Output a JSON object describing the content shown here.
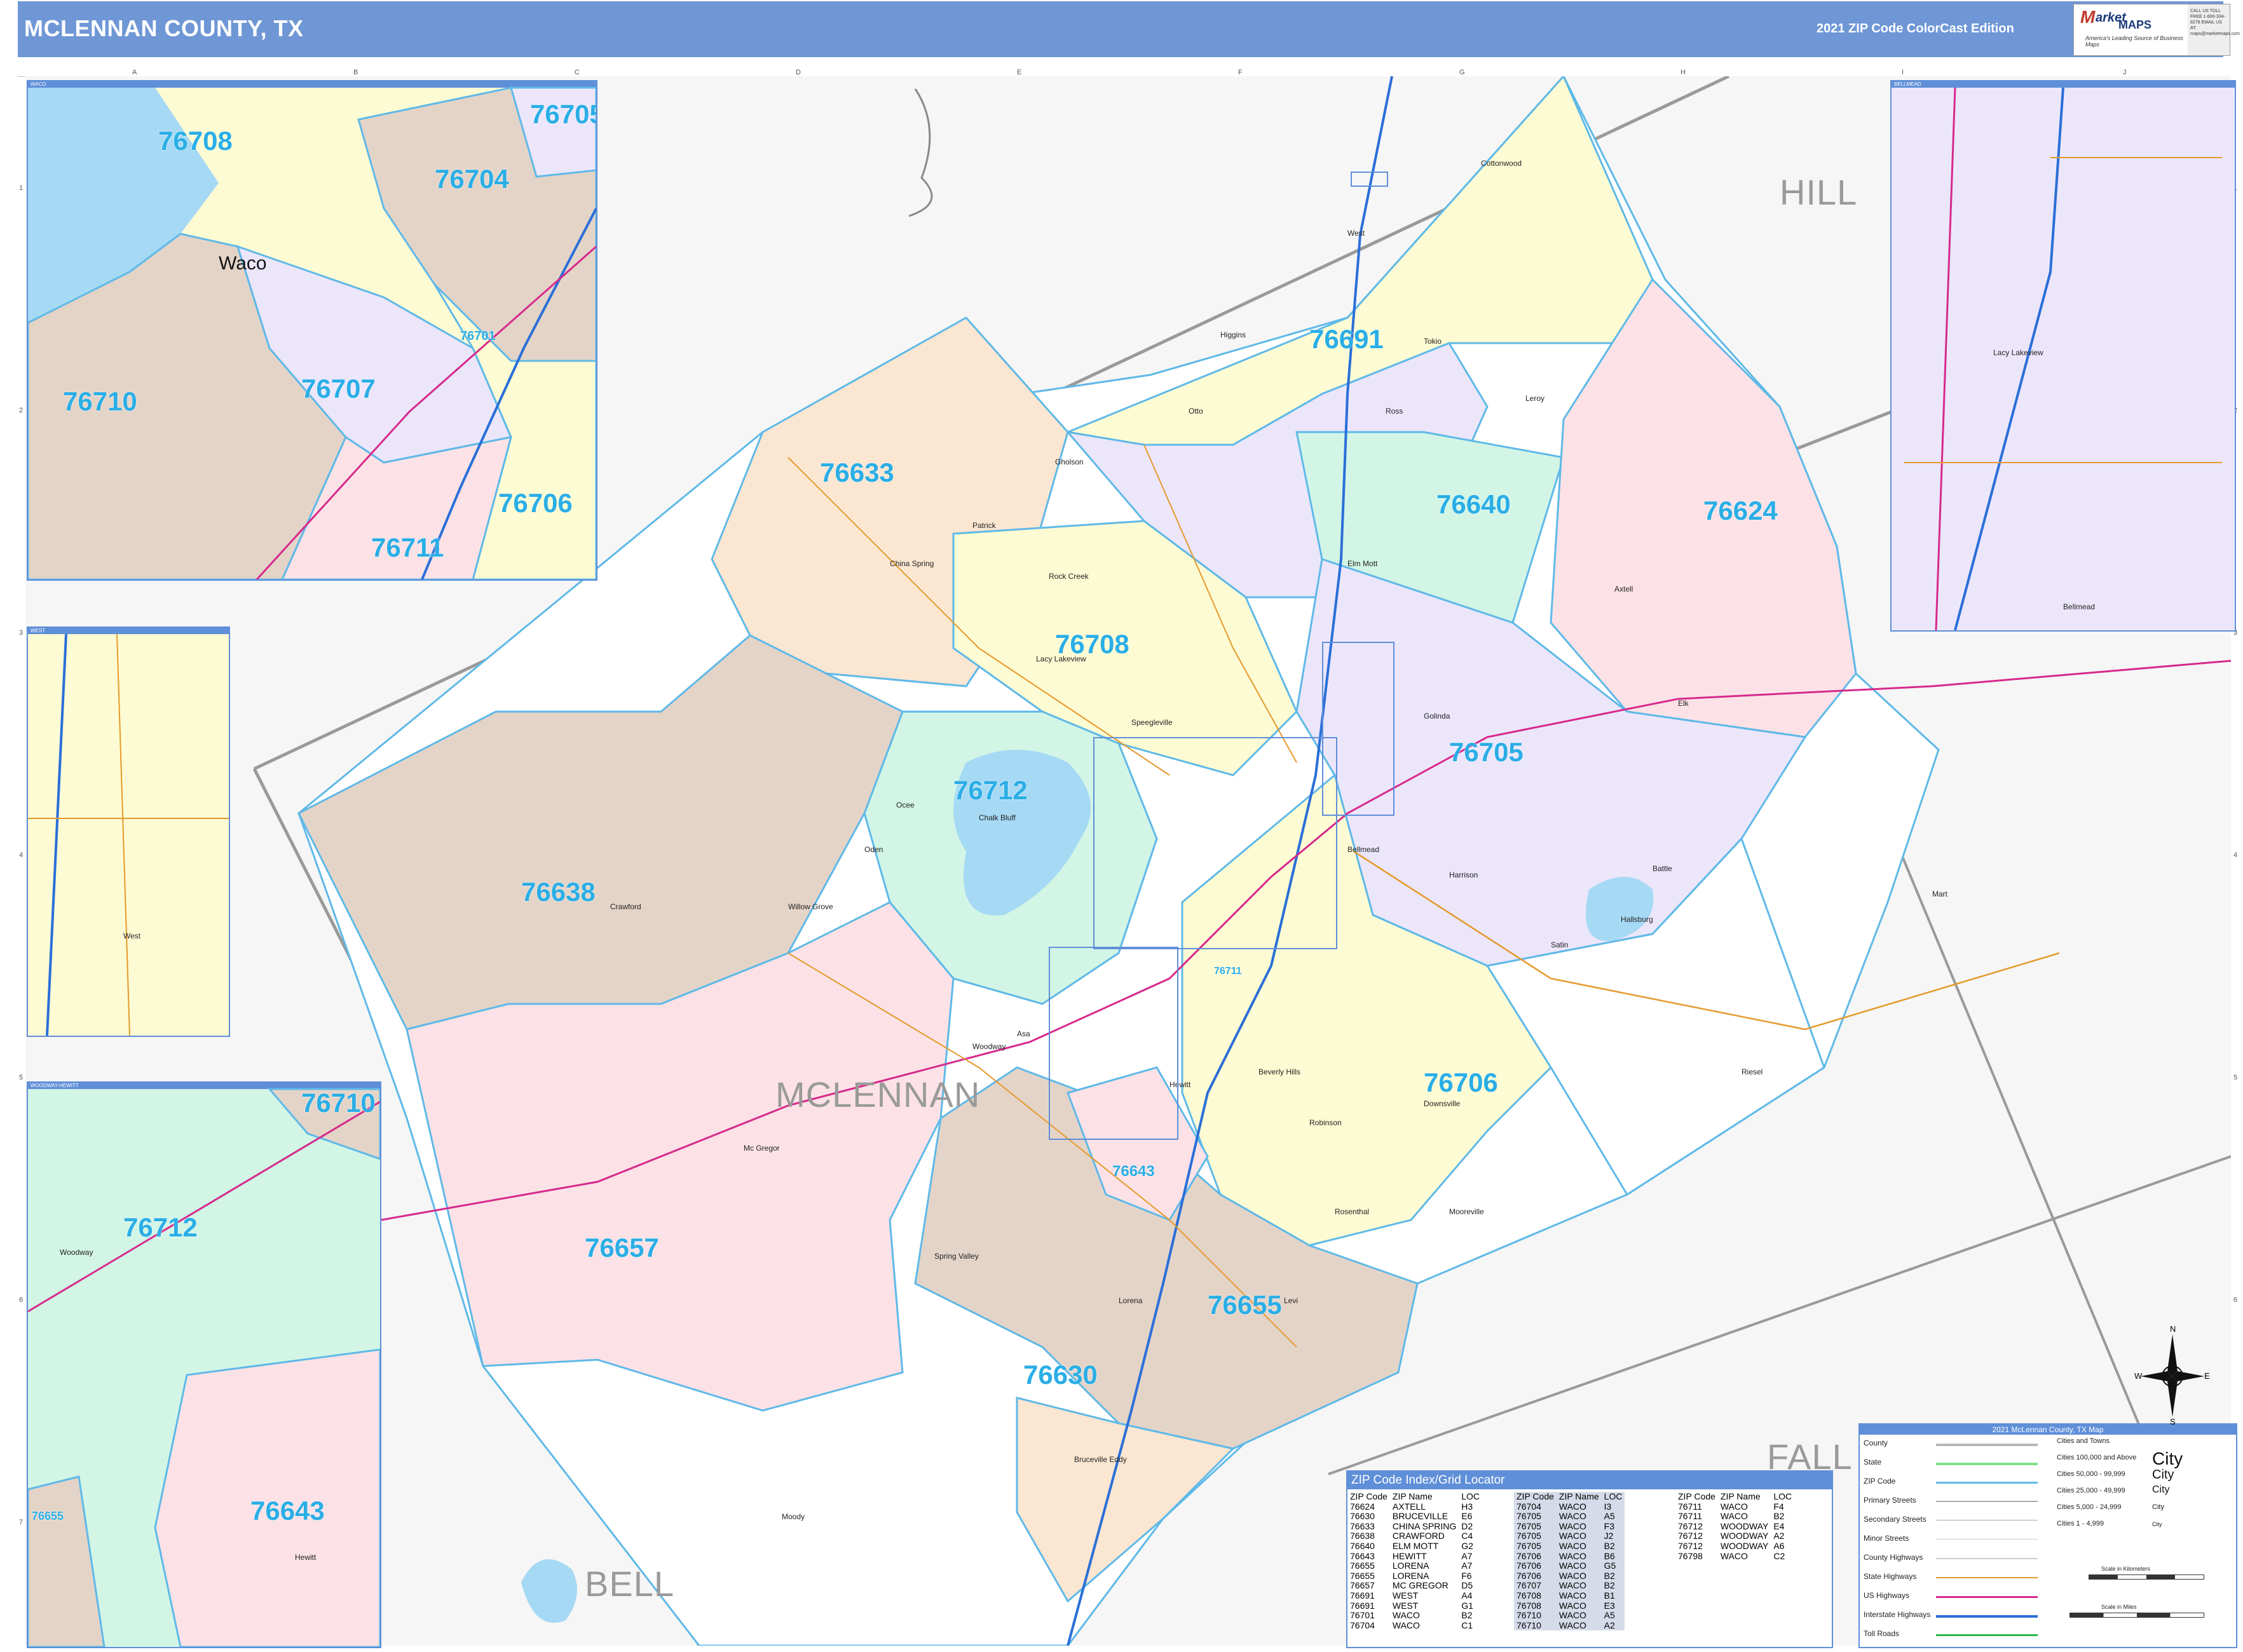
{
  "header": {
    "title": "MCLENNAN COUNTY, TX",
    "edition": "2021 ZIP Code ColorCast Edition"
  },
  "logo": {
    "brand_m": "M",
    "brand_rest": "arket",
    "brand_maps": "MAPS",
    "slogan": "America's Leading Source of Business Maps",
    "contact": "CALL US TOLL FREE 1-800-334-8278 EMAIL US AT: maps@marketmaps.com"
  },
  "grid": {
    "columns": [
      "A",
      "B",
      "C",
      "D",
      "E",
      "F",
      "G",
      "H",
      "I",
      "J"
    ],
    "rows": [
      "1",
      "2",
      "3",
      "4",
      "5",
      "6",
      "7"
    ]
  },
  "map": {
    "county_labels": {
      "hill": "HILL",
      "mclennan": "MCLENNAN",
      "bell": "BELL",
      "falls": "FALL"
    },
    "zips": {
      "z76691": "76691",
      "z76633": "76633",
      "z76640": "76640",
      "z76624": "76624",
      "z76708": "76708",
      "z76712": "76712",
      "z76705": "76705",
      "z76638": "76638",
      "z76706": "76706",
      "z76657": "76657",
      "z76643": "76643",
      "z76655": "76655",
      "z76630": "76630",
      "z76711": "76711"
    },
    "places": {
      "west": "West",
      "gholson": "Gholson",
      "china_spring": "China Spring",
      "rock_creek": "Rock Creek",
      "crawford": "Crawford",
      "speegleville": "Speegleville",
      "lacy_lakeview": "Lacy Lakeview",
      "bellmead": "Bellmead",
      "mcgregor": "Mc Gregor",
      "moody": "Moody",
      "bruceville": "Bruceville Eddy",
      "lorena": "Lorena",
      "hewitt": "Hewitt",
      "robinson": "Robinson",
      "mart": "Mart",
      "riesel": "Riesel",
      "axtell": "Axtell",
      "elm_mott": "Elm Mott",
      "leroy": "Leroy",
      "ross": "Ross",
      "tokio": "Tokio",
      "otto": "Otto",
      "elk": "Elk",
      "hallsburg": "Hallsburg",
      "harrison": "Harrison",
      "downsville": "Downsville",
      "levi": "Levi",
      "rosenthal": "Rosenthal",
      "spring_valley": "Spring Valley",
      "golinda": "Golinda",
      "beverly_hills": "Beverly Hills",
      "woodway": "Woodway",
      "cottonwood": "Cottonwood",
      "higgins": "Higgins",
      "patrick": "Patrick",
      "battle": "Battle",
      "satin": "Satin",
      "chalk_bluff": "Chalk Bluff",
      "downsville2": "Willow Grove",
      "oden": "Oden",
      "asa": "Asa",
      "mooreville": "Mooreville",
      "ocee": "Ocee"
    },
    "inset_titles": {
      "waco": "WACO",
      "bellmead": "BELLMEAD",
      "west": "WEST",
      "woodway_hewitt": "WOODWAY-HEWITT"
    },
    "inset_waco": {
      "city": "Waco",
      "zips": [
        "76708",
        "76704",
        "76705",
        "76710",
        "76707",
        "76701",
        "76706",
        "76711"
      ]
    },
    "inset_woodway": {
      "zips": [
        "76710",
        "76712",
        "76643",
        "76655"
      ]
    }
  },
  "index": {
    "title": "ZIP Code Index/Grid Locator",
    "headers": [
      "ZIP Code",
      "ZIP Name",
      "LOC"
    ],
    "col1": [
      [
        "76624",
        "AXTELL",
        "H3"
      ],
      [
        "76630",
        "BRUCEVILLE",
        "E6"
      ],
      [
        "76633",
        "CHINA SPRING",
        "D2"
      ],
      [
        "76638",
        "CRAWFORD",
        "C4"
      ],
      [
        "76640",
        "ELM MOTT",
        "G2"
      ],
      [
        "76643",
        "HEWITT",
        "A7"
      ],
      [
        "76655",
        "LORENA",
        "A7"
      ],
      [
        "76655",
        "LORENA",
        "F6"
      ],
      [
        "76657",
        "MC GREGOR",
        "D5"
      ],
      [
        "76691",
        "WEST",
        "A4"
      ],
      [
        "76691",
        "WEST",
        "G1"
      ],
      [
        "76701",
        "WACO",
        "B2"
      ],
      [
        "76704",
        "WACO",
        "C1"
      ]
    ],
    "col2": [
      [
        "76704",
        "WACO",
        "I3"
      ],
      [
        "76705",
        "WACO",
        "A5"
      ],
      [
        "76705",
        "WACO",
        "F3"
      ],
      [
        "76705",
        "WACO",
        "J2"
      ],
      [
        "76705",
        "WACO",
        "B2"
      ],
      [
        "76706",
        "WACO",
        "B6"
      ],
      [
        "76706",
        "WACO",
        "G5"
      ],
      [
        "76706",
        "WACO",
        "B2"
      ],
      [
        "76707",
        "WACO",
        "B2"
      ],
      [
        "76708",
        "WACO",
        "B1"
      ],
      [
        "76708",
        "WACO",
        "E3"
      ],
      [
        "76710",
        "WACO",
        "A5"
      ],
      [
        "76710",
        "WACO",
        "A2"
      ]
    ],
    "col3": [
      [
        "76711",
        "WACO",
        "F4"
      ],
      [
        "76711",
        "WACO",
        "B2"
      ],
      [
        "76712",
        "WOODWAY",
        "E4"
      ],
      [
        "76712",
        "WOODWAY",
        "A2"
      ],
      [
        "76712",
        "WOODWAY",
        "A6"
      ],
      [
        "76798",
        "WACO",
        "C2"
      ]
    ]
  },
  "legend": {
    "title": "2021 McLennan County, TX Map",
    "rows": [
      "County",
      "State",
      "ZIP Code",
      "Primary Streets",
      "Secondary Streets",
      "Minor Streets",
      "County Highways",
      "State Highways",
      "US Highways",
      "Interstate Highways",
      "Toll Roads"
    ],
    "cities_header": "Cities and Towns",
    "cities": [
      [
        "Cities 100,000 and Above",
        "City"
      ],
      [
        "Cities 50,000 - 99,999",
        "City"
      ],
      [
        "Cities 25,000 - 49,999",
        "City"
      ],
      [
        "Cities 5,000 - 24,999",
        "City"
      ],
      [
        "Cities 1 - 4,999",
        "City"
      ]
    ],
    "scale_km": "Scale in Kilometers",
    "scale_mi": "Scale in Miles"
  },
  "compass": {
    "n": "N",
    "s": "S",
    "e": "E",
    "w": "W"
  },
  "colors": {
    "header": "#6f97d6",
    "zip_label": "#2aaee6",
    "yellow": "#fdfbd3",
    "lavender": "#ece6fb",
    "peach": "#fbe6d2",
    "tan": "#e4d4c8",
    "mint": "#d2f5e6",
    "pink": "#fce2e6"
  }
}
